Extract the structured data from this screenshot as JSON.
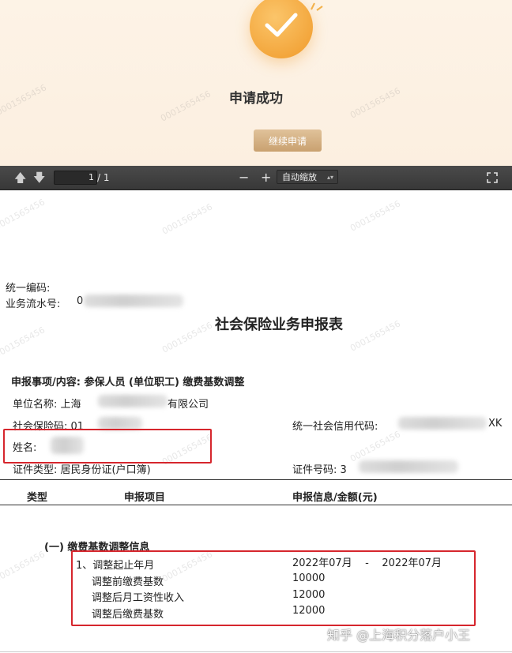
{
  "banner": {
    "title": "申请成功",
    "continue_label": "继续申请",
    "accent": "#f09a2a"
  },
  "toolbar": {
    "page_current": "1",
    "page_total": "/ 1",
    "zoom_minus": "−",
    "zoom_plus": "+",
    "zoom_value": "自动缩放"
  },
  "watermark": "0001565456",
  "doc": {
    "unified_code_label": "统一编码:",
    "serial_label": "业务流水号:",
    "serial_prefix": "0",
    "title": "社会保险业务申报表",
    "item_label": "申报事项/内容: 参保人员 (单位职工) 缴费基数调整",
    "unit_label": "单位名称: 上海",
    "unit_suffix": "有限公司",
    "si_code_label": "社会保险码: 01",
    "credit_code_label": "统一社会信用代码:",
    "credit_code_suffix": "XK",
    "name_label": "姓名: ",
    "id_type_label": "证件类型: 居民身份证(户口簿)",
    "id_no_label": "证件号码: 3",
    "table": {
      "col_type": "类型",
      "col_item": "申报项目",
      "col_value": "申报信息/金额(元)"
    },
    "section_title": "(一) 缴费基数调整信息",
    "rows": [
      {
        "label": "1、调整起止年月",
        "value": "2022年07月    -    2022年07月"
      },
      {
        "label": "调整前缴费基数",
        "value": "10000"
      },
      {
        "label": "调整后月工资性收入",
        "value": "12000"
      },
      {
        "label": "调整后缴费基数",
        "value": "12000"
      }
    ]
  },
  "credit": "知乎 @上海积分落户小王",
  "colors": {
    "highlight": "#d6262d"
  }
}
